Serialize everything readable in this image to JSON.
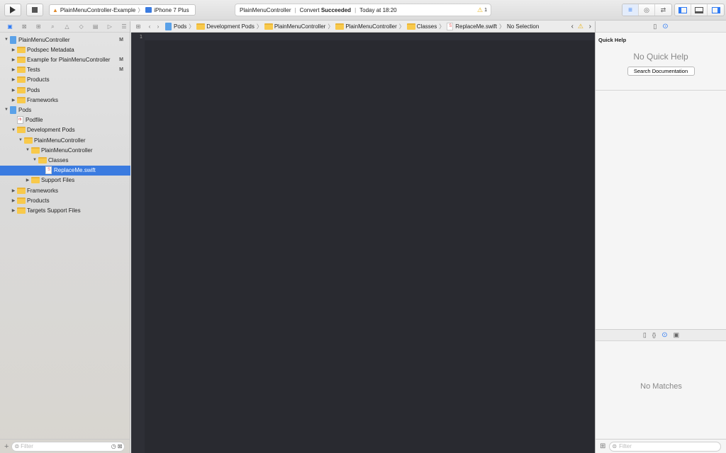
{
  "toolbar": {
    "run_icon": "play-icon",
    "stop_icon": "stop-icon",
    "scheme": "PlainMenuController-Example",
    "device": "iPhone 7 Plus",
    "activity": {
      "project": "PlainMenuController",
      "status_prefix": "Convert",
      "status_bold": "Succeeded",
      "time": "Today at 18:20",
      "warnings": "1"
    }
  },
  "navigator": {
    "tree": [
      {
        "label": "PlainMenuController",
        "kind": "project",
        "indent": 0,
        "expanded": true,
        "badge": "M"
      },
      {
        "label": "Podspec Metadata",
        "kind": "folder",
        "indent": 1,
        "expanded": false,
        "badge": ""
      },
      {
        "label": "Example for PlainMenuController",
        "kind": "folder",
        "indent": 1,
        "expanded": false,
        "badge": "M"
      },
      {
        "label": "Tests",
        "kind": "folder",
        "indent": 1,
        "expanded": false,
        "badge": "M"
      },
      {
        "label": "Products",
        "kind": "folder",
        "indent": 1,
        "expanded": false,
        "badge": ""
      },
      {
        "label": "Pods",
        "kind": "folder",
        "indent": 1,
        "expanded": false,
        "badge": ""
      },
      {
        "label": "Frameworks",
        "kind": "folder",
        "indent": 1,
        "expanded": false,
        "badge": ""
      },
      {
        "label": "Pods",
        "kind": "project",
        "indent": 0,
        "expanded": true,
        "badge": ""
      },
      {
        "label": "Podfile",
        "kind": "podfile",
        "indent": 1,
        "expanded": null,
        "badge": ""
      },
      {
        "label": "Development Pods",
        "kind": "folder",
        "indent": 1,
        "expanded": true,
        "badge": ""
      },
      {
        "label": "PlainMenuController",
        "kind": "folder",
        "indent": 2,
        "expanded": true,
        "badge": ""
      },
      {
        "label": "PlainMenuController",
        "kind": "folder",
        "indent": 3,
        "expanded": true,
        "badge": ""
      },
      {
        "label": "Classes",
        "kind": "folder",
        "indent": 4,
        "expanded": true,
        "badge": ""
      },
      {
        "label": "ReplaceMe.swift",
        "kind": "swift",
        "indent": 5,
        "expanded": null,
        "badge": "",
        "selected": true
      },
      {
        "label": "Support Files",
        "kind": "folder",
        "indent": 3,
        "expanded": false,
        "badge": ""
      },
      {
        "label": "Frameworks",
        "kind": "folder",
        "indent": 1,
        "expanded": false,
        "badge": ""
      },
      {
        "label": "Products",
        "kind": "folder",
        "indent": 1,
        "expanded": false,
        "badge": ""
      },
      {
        "label": "Targets Support Files",
        "kind": "folder",
        "indent": 1,
        "expanded": false,
        "badge": ""
      }
    ],
    "filter_placeholder": "Filter"
  },
  "editor": {
    "jumpbar": [
      "Pods",
      "Development Pods",
      "PlainMenuController",
      "PlainMenuController",
      "Classes",
      "ReplaceMe.swift",
      "No Selection"
    ],
    "line_number": "1"
  },
  "inspector": {
    "quick_help_title": "Quick Help",
    "no_quick_help": "No Quick Help",
    "search_doc": "Search Documentation",
    "no_matches": "No Matches",
    "filter_placeholder": "Filter"
  },
  "colors": {
    "accent": "#3a7be0",
    "editor_bg": "#292a30",
    "folder": "#f8c94b"
  }
}
